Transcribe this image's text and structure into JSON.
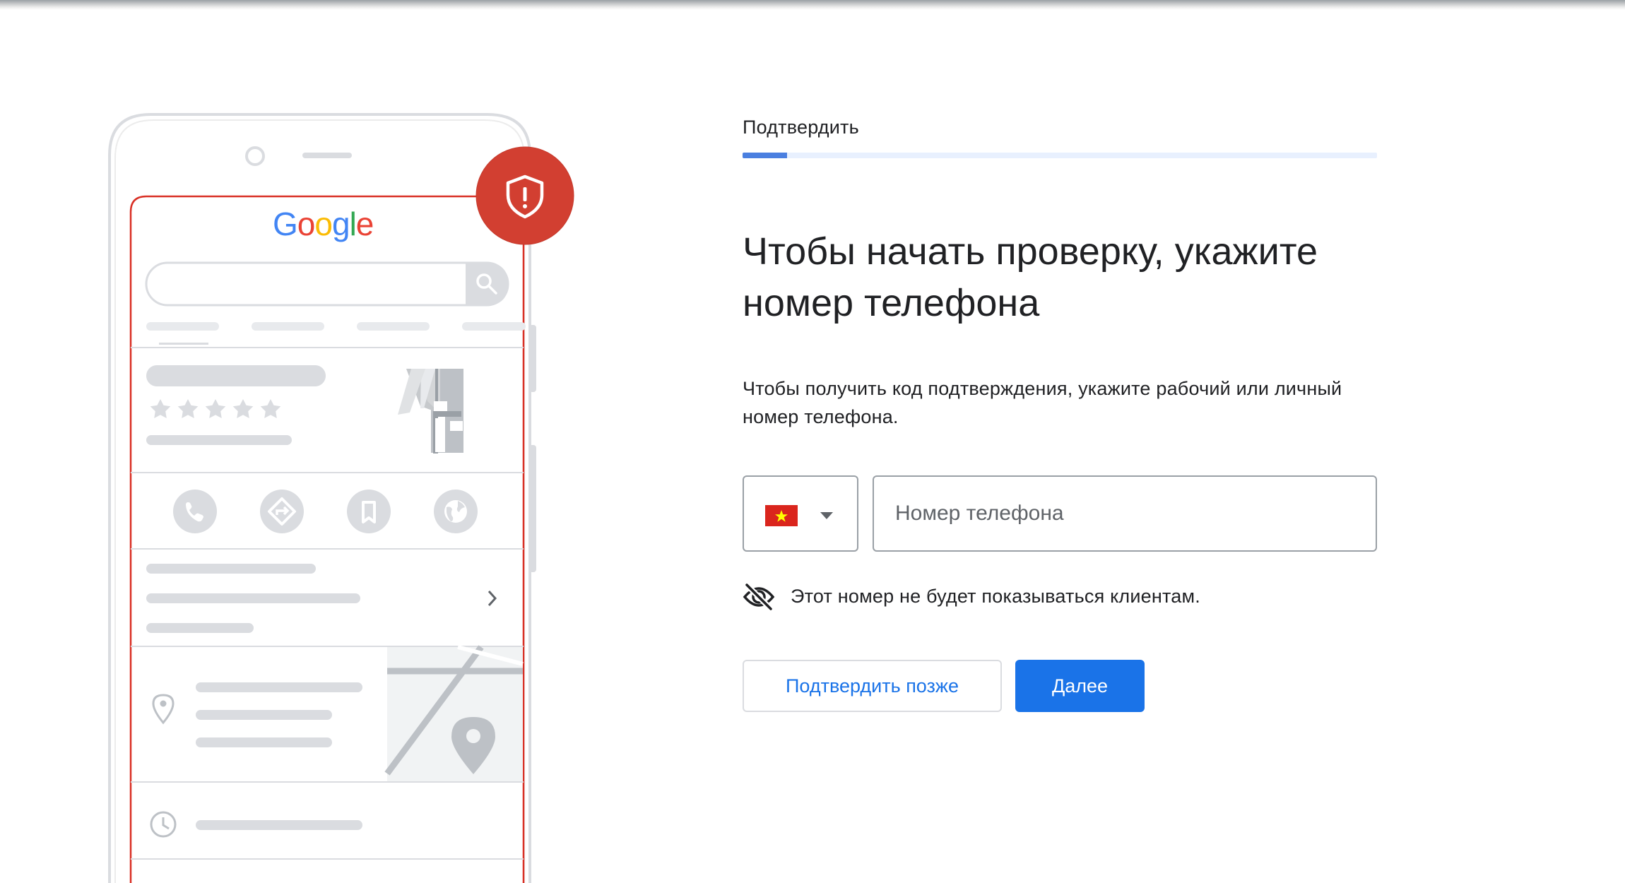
{
  "step": {
    "label": "Подтвердить",
    "progress": 0.07
  },
  "heading": "Чтобы начать проверку, укажите номер телефона",
  "subtext": "Чтобы получить код подтверждения, укажите рабочий или личный номер телефона.",
  "country_select": {
    "flag": "vietnam-flag",
    "icon": "arrow-drop-down-icon"
  },
  "phone_input": {
    "placeholder": "Номер телефона",
    "value": ""
  },
  "privacy_note": {
    "icon": "visibility-off-icon",
    "text": "Этот номер не будет показываться клиентам."
  },
  "buttons": {
    "later": "Подтвердить позже",
    "next": "Далее"
  },
  "illustration": {
    "logo": "Google",
    "rating_icon": "star-icon",
    "action_icons": [
      "phone-icon",
      "directions-icon",
      "bookmark-icon",
      "globe-icon"
    ],
    "detail_icons": [
      "chevron-right-icon",
      "location-pin-icon",
      "clock-icon"
    ],
    "badge_icon": "shield-alert-icon"
  },
  "colors": {
    "primary": "#1a73e8",
    "badge_red": "#d23f31",
    "frame_red": "#d93025",
    "placeholder_gray": "#dadce0",
    "progress_fill": "#4a7fe0",
    "progress_track": "#e8f0fe"
  }
}
